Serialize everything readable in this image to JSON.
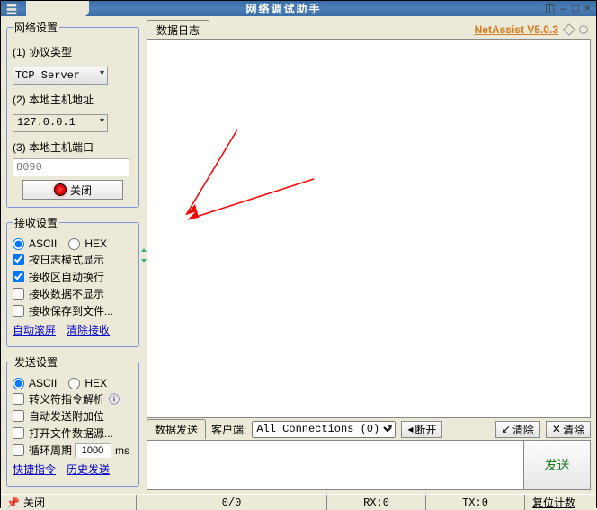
{
  "title": "网络调试助手",
  "brand": "NetAssist V5.0.3",
  "sidebar": {
    "net": {
      "legend": "网络设置",
      "proto_label": "(1) 协议类型",
      "proto_value": "TCP Server",
      "host_label": "(2) 本地主机地址",
      "host_value": "127.0.0.1",
      "port_label": "(3) 本地主机端口",
      "port_value": "8090",
      "listen_btn": "关闭"
    },
    "recv": {
      "legend": "接收设置",
      "ascii": "ASCII",
      "hex": "HEX",
      "log_mode": "按日志模式显示",
      "auto_wrap": "接收区自动换行",
      "no_show": "接收数据不显示",
      "to_file": "接收保存到文件...",
      "auto_scroll": "自动滚屏",
      "clear_recv": "清除接收"
    },
    "send": {
      "legend": "发送设置",
      "ascii": "ASCII",
      "hex": "HEX",
      "escape": "转义符指令解析",
      "auto_append": "自动发送附加位",
      "open_src": "打开文件数据源...",
      "cycle_lbl": "循环周期",
      "cycle_val": "1000",
      "cycle_ms": "ms",
      "shortcut": "快捷指令",
      "history": "历史发送"
    }
  },
  "log": {
    "tab": "数据日志"
  },
  "sendbar": {
    "tab1": "数据发送",
    "tab2": "客户端:",
    "conn": "All Connections (0)",
    "disconnect": "断开",
    "clear_l": "清除",
    "clear_r": "清除",
    "send_btn": "发送"
  },
  "status": {
    "state": "关闭",
    "counter": "0/0",
    "rx": "RX:0",
    "tx": "TX:0",
    "reset": "复位计数"
  }
}
